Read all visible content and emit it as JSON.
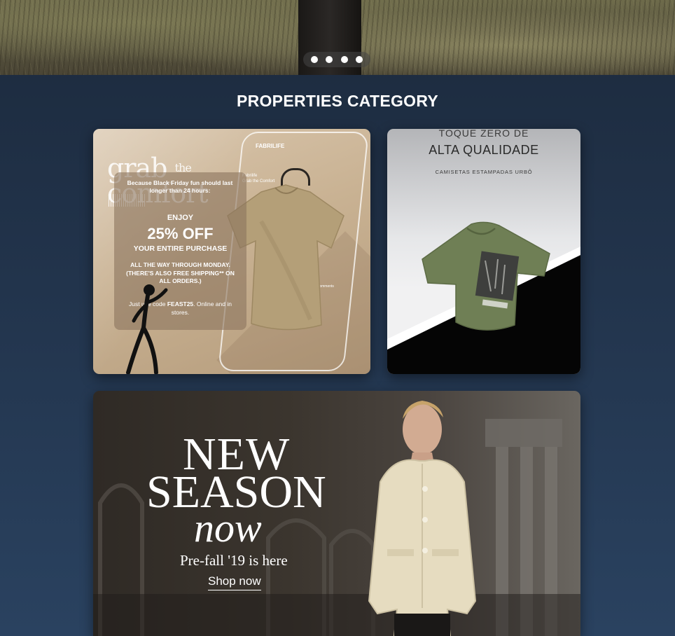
{
  "hero": {
    "slides_count": 4,
    "active_slide": 1
  },
  "section": {
    "title": "PROPERTIES CATEGORY"
  },
  "cards": {
    "promo": {
      "brand_script": "grab",
      "brand_script_the": "the",
      "brand_script_comfort": "comfort",
      "phone_brand": "FABRILIFE",
      "phone_user": "Fabrilife",
      "phone_user_sub": "Grab the Comfort",
      "phone_comments": "965 Comments",
      "intro": "Because Black Friday fun should last longer than 24 hours:",
      "enjoy": "ENJOY",
      "discount": "25% OFF",
      "purchase": "YOUR ENTIRE PURCHASE",
      "details": "ALL THE WAY THROUGH MONDAY. (THERE'S ALSO FREE SHIPPING** ON ALL ORDERS.)",
      "code_prefix": "Just use code ",
      "code": "FEAST25",
      "code_suffix": ". Online and in stores."
    },
    "shirt": {
      "line1": "TOQUE ZERO DE",
      "line2": "ALTA QUALIDADE",
      "line3": "CAMISETAS ESTAMPADAS URBÔ"
    },
    "new_season": {
      "line1": "NEW",
      "line2": "SEASON",
      "line3": "now",
      "subtitle": "Pre-fall '19 is here",
      "cta": "Shop now"
    }
  },
  "colors": {
    "background": "#22344c",
    "promo_bg": "#c9b293",
    "shirt_green": "#6f7f55",
    "coat_cream": "#e6dcc0"
  }
}
